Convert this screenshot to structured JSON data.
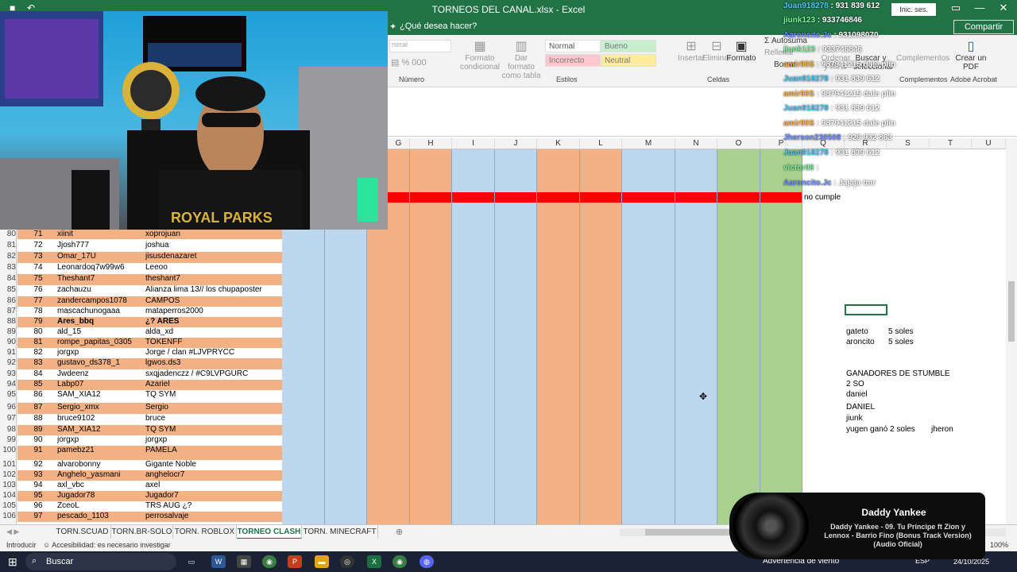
{
  "window": {
    "title": "TORNEOS DEL CANAL.xlsx  -  Excel",
    "signin": "Inic. ses.",
    "share": "Compartir"
  },
  "tellme": "¿Qué desea hacer?",
  "ribbon": {
    "groups": [
      "Número",
      "Estilos",
      "Celdas",
      "Complementos",
      "Adobe Acrobat"
    ],
    "format_cond": "Formato condicional",
    "format_table": "Dar formato como tabla",
    "styles": [
      "Normal",
      "Bueno",
      "Incorrecto",
      "Neutral"
    ],
    "insert": "Insertar",
    "delete": "Eliminar",
    "format": "Formato",
    "autosum": "Autosuma",
    "fill": "Rellenar",
    "clear": "Borrar",
    "sort": "Ordenar y filtrar",
    "find": "Buscar y seleccionar",
    "addins": "Complementos",
    "pdf": "Crear un PDF"
  },
  "columns": [
    "G",
    "H",
    "I",
    "J",
    "K",
    "L",
    "M",
    "N",
    "O",
    "P",
    "Q",
    "R",
    "S",
    "T",
    "U"
  ],
  "top_note": "no cumple",
  "rows": [
    {
      "n": "80",
      "a": "71",
      "b": "xiinit",
      "c": "xoprojuan",
      "bg": "#f4b183"
    },
    {
      "n": "81",
      "a": "72",
      "b": "Jjosh777",
      "c": "joshua",
      "bg": "#ffffff"
    },
    {
      "n": "82",
      "a": "73",
      "b": "Omar_17U",
      "c": "jisusdenazaret",
      "bg": "#f4b183"
    },
    {
      "n": "83",
      "a": "74",
      "b": "Leonardoq7w99w6",
      "c": "Leeoo",
      "bg": "#ffffff"
    },
    {
      "n": "84",
      "a": "75",
      "b": "Theshant7",
      "c": "theshant7",
      "bg": "#f4b183"
    },
    {
      "n": "85",
      "a": "76",
      "b": "zachauzu",
      "c": "Alianza lima 13// los chupaposter",
      "bg": "#ffffff"
    },
    {
      "n": "86",
      "a": "77",
      "b": "zandercampos1078",
      "c": "CAMPOS",
      "bg": "#f4b183"
    },
    {
      "n": "87",
      "a": "78",
      "b": "mascachunogaaa",
      "c": "mataperros2000",
      "bg": "#ffffff"
    },
    {
      "n": "88",
      "a": "79",
      "b": "Ares_bbq",
      "c": "¿? ARES",
      "bg": "#f4b183",
      "bold": true
    },
    {
      "n": "89",
      "a": "80",
      "b": "ald_15",
      "c": "alda_xd",
      "bg": "#ffffff"
    },
    {
      "n": "90",
      "a": "81",
      "b": "rompe_papitas_0305",
      "c": "TOKENFF",
      "bg": "#f4b183"
    },
    {
      "n": "91",
      "a": "82",
      "b": "jorgxp",
      "c": "Jorge / clan #LJVPRYCC",
      "bg": "#ffffff"
    },
    {
      "n": "92",
      "a": "83",
      "b": "gustavo_ds378_1",
      "c": "lgwos.ds3",
      "bg": "#f4b183"
    },
    {
      "n": "93",
      "a": "84",
      "b": "Jwdeenz",
      "c": "sxqjadenczz / #C9LVPGURC",
      "bg": "#ffffff"
    },
    {
      "n": "94",
      "a": "85",
      "b": "Labp07",
      "c": "Azariel",
      "bg": "#f4b183"
    },
    {
      "n": "95",
      "a": "86",
      "b": "SAM_XIA12",
      "c": "TQ SYM",
      "bg": "#ffffff"
    },
    {
      "n": "96",
      "a": "87",
      "b": "Sergio_xmx",
      "c": "Sergio",
      "bg": "#f4b183"
    },
    {
      "n": "97",
      "a": "88",
      "b": "bruce9102",
      "c": "bruce",
      "bg": "#ffffff"
    },
    {
      "n": "98",
      "a": "89",
      "b": "SAM_XIA12",
      "c": "TQ SYM",
      "bg": "#f4b183"
    },
    {
      "n": "99",
      "a": "90",
      "b": "jorgxp",
      "c": "jorgxp",
      "bg": "#ffffff"
    },
    {
      "n": "100",
      "a": "91",
      "b": "pamebz21",
      "c": "PAMELA",
      "bg": "#f4b183"
    },
    {
      "n": "101",
      "a": "92",
      "b": "alvarobonny",
      "c": "Gigante Noble",
      "bg": "#ffffff"
    },
    {
      "n": "102",
      "a": "93",
      "b": "Anghelo_yasmani",
      "c": "anghelocr7",
      "bg": "#f4b183"
    },
    {
      "n": "103",
      "a": "94",
      "b": "axl_vbc",
      "c": "axel",
      "bg": "#ffffff"
    },
    {
      "n": "104",
      "a": "95",
      "b": "Jugador78",
      "c": "Jugador7",
      "bg": "#f4b183"
    },
    {
      "n": "105",
      "a": "96",
      "b": "ZceoL",
      "c": "TRS AUG ¿?",
      "bg": "#ffffff"
    },
    {
      "n": "106",
      "a": "97",
      "b": "pescado_1103",
      "c": "perrosalvaje",
      "bg": "#f4b183"
    }
  ],
  "side_notes": {
    "gateto": "gateto",
    "gateto_prize": "5 soles",
    "aroncito": "aroncito",
    "aroncito_prize": "5 soles",
    "winners_title": "GANADORES DE STUMBLE",
    "w1": "2 SO",
    "w2": "daniel",
    "w3": "DANIEL",
    "w4": "jiunk",
    "w5": "yugen ganó 2 soles",
    "w5b": "jheron"
  },
  "sheet_tabs": [
    "TORN.SCUAD",
    "TORN.BR-SOLO",
    "TORN. ROBLOX",
    "TORNEO CLASH",
    "TORN. MINECRAFT"
  ],
  "active_tab": "TORNEO CLASH",
  "status": {
    "mode": "Introducir",
    "accessibility": "Accesibilidad: es necesario investigar",
    "zoom": "100%"
  },
  "taskbar": {
    "search": "Buscar",
    "weather": "Advertencia de viento",
    "lang": "ESP",
    "date": "24/10/2025"
  },
  "chat": [
    {
      "user": "Juan918278",
      "msg": "931 839 612",
      "color": "#4fc3f7"
    },
    {
      "user": "jiunk123",
      "msg": "933746846",
      "color": "#7cf29a"
    },
    {
      "user": "Aaroncito.Jc",
      "msg": "931098070",
      "color": "#6b8cff"
    },
    {
      "user": "jiunk123",
      "msg": "933746846",
      "color": "#7cf29a"
    },
    {
      "user": "amir90S",
      "msg": "987941215 dale plin",
      "color": "#ffae42"
    },
    {
      "user": "Juan918278",
      "msg": "931 839 612",
      "color": "#4fc3f7"
    },
    {
      "user": "amir90S",
      "msg": "987941215 dale plin",
      "color": "#ffae42"
    },
    {
      "user": "Juan918278",
      "msg": "931 839 612",
      "color": "#4fc3f7"
    },
    {
      "user": "amir90S",
      "msg": "987941215 dale plin",
      "color": "#ffae42"
    },
    {
      "user": "Jherson230508",
      "msg": "929 932 863",
      "color": "#6b8cff"
    },
    {
      "user": "Juan918278",
      "msg": "931 839 612",
      "color": "#4fc3f7"
    },
    {
      "user": "victor08",
      "msg": "",
      "color": "#7cf29a"
    },
    {
      "user": "Aaroncito.Jc",
      "msg": "Jajaja tmr",
      "color": "#6b8cff"
    }
  ],
  "music": {
    "artist": "Daddy Yankee",
    "track": "Daddy Yankee - 09. Tu Príncipe ft Zion y Lennox - Barrio Fino (Bonus Track Version) (Audio Oficial)"
  },
  "webcam": {
    "shirt_text": "ROYAL PARKS"
  }
}
